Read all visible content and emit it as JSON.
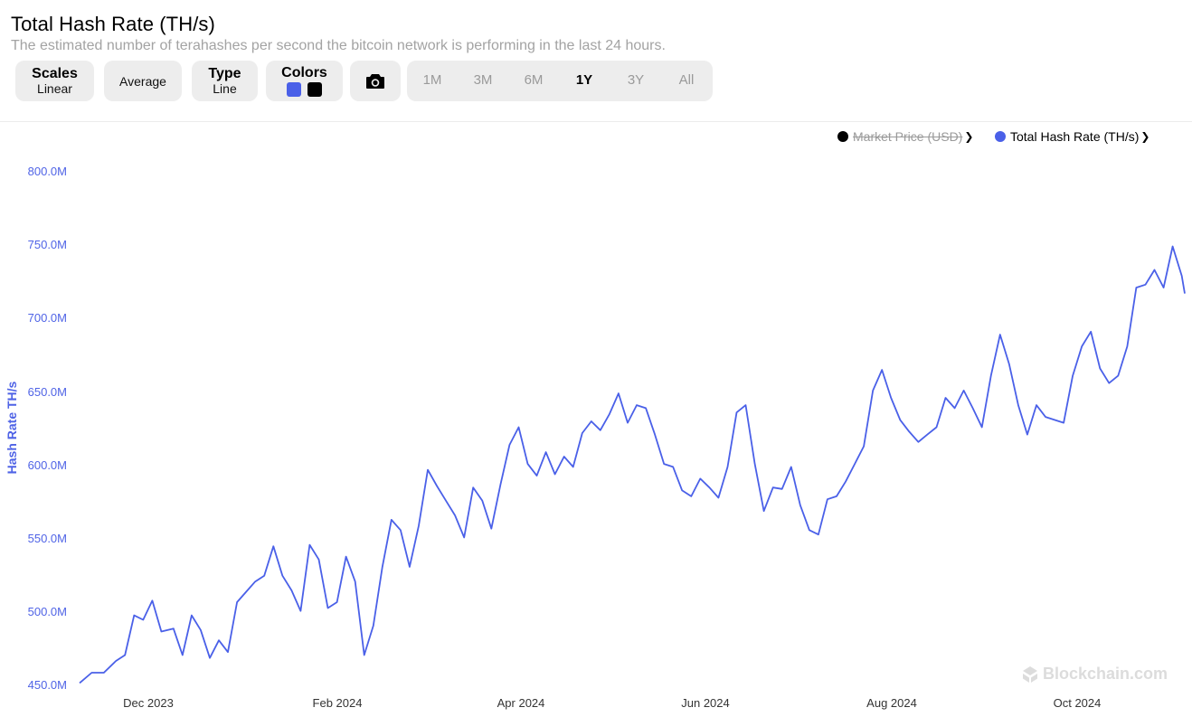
{
  "header": {
    "title": "Total Hash Rate (TH/s)",
    "subtitle": "The estimated number of terahashes per second the bitcoin network is performing in the last 24 hours."
  },
  "controls": {
    "scales": {
      "label": "Scales",
      "value": "Linear"
    },
    "average": {
      "label": "Average"
    },
    "type": {
      "label": "Type",
      "value": "Line"
    },
    "colors": {
      "label": "Colors",
      "swatch1": "#4a60e8",
      "swatch2": "#000000"
    },
    "camera": {
      "icon": "camera-icon"
    },
    "ranges": [
      "1M",
      "3M",
      "6M",
      "1Y",
      "3Y",
      "All"
    ],
    "active_range": "1Y"
  },
  "legend": [
    {
      "label": "Market Price (USD)",
      "color": "#000000",
      "enabled": false
    },
    {
      "label": "Total Hash Rate (TH/s)",
      "color": "#4a60e8",
      "enabled": true
    }
  ],
  "watermark": "Blockchain.com",
  "chart_data": {
    "type": "line",
    "title": "Total Hash Rate (TH/s)",
    "ylabel": "Hash Rate TH/s",
    "xlabel": "",
    "ylim": [
      450,
      800
    ],
    "y_unit": "M TH/s",
    "yticks": [
      "450.0M",
      "500.0M",
      "550.0M",
      "600.0M",
      "650.0M",
      "700.0M",
      "750.0M",
      "800.0M"
    ],
    "ytick_values": [
      450,
      500,
      550,
      600,
      650,
      700,
      750,
      800
    ],
    "xticks": [
      "Dec 2023",
      "Feb 2024",
      "Apr 2024",
      "Jun 2024",
      "Aug 2024",
      "Oct 2024"
    ],
    "xtick_dates": [
      "2023-12-01",
      "2024-02-01",
      "2024-04-01",
      "2024-06-01",
      "2024-08-01",
      "2024-10-01"
    ],
    "x_range": [
      "2023-11-12",
      "2024-11-11"
    ],
    "grid": false,
    "legend_position": "top-right",
    "series": [
      {
        "name": "Total Hash Rate (TH/s)",
        "color": "#4a60e8",
        "points": [
          [
            "2023-11-12",
            451
          ],
          [
            "2023-11-16",
            458
          ],
          [
            "2023-11-20",
            458
          ],
          [
            "2023-11-24",
            466
          ],
          [
            "2023-11-27",
            470
          ],
          [
            "2023-11-30",
            497
          ],
          [
            "2023-12-03",
            494
          ],
          [
            "2023-12-06",
            507
          ],
          [
            "2023-12-09",
            486
          ],
          [
            "2023-12-13",
            488
          ],
          [
            "2023-12-16",
            470
          ],
          [
            "2023-12-19",
            497
          ],
          [
            "2023-12-22",
            487
          ],
          [
            "2023-12-25",
            468
          ],
          [
            "2023-12-28",
            480
          ],
          [
            "2023-12-31",
            472
          ],
          [
            "2024-01-03",
            506
          ],
          [
            "2024-01-06",
            513
          ],
          [
            "2024-01-09",
            520
          ],
          [
            "2024-01-12",
            524
          ],
          [
            "2024-01-15",
            544
          ],
          [
            "2024-01-18",
            524
          ],
          [
            "2024-01-21",
            514
          ],
          [
            "2024-01-24",
            500
          ],
          [
            "2024-01-27",
            545
          ],
          [
            "2024-01-30",
            535
          ],
          [
            "2024-02-02",
            502
          ],
          [
            "2024-02-05",
            506
          ],
          [
            "2024-02-08",
            537
          ],
          [
            "2024-02-11",
            520
          ],
          [
            "2024-02-14",
            470
          ],
          [
            "2024-02-17",
            490
          ],
          [
            "2024-02-20",
            530
          ],
          [
            "2024-02-23",
            562
          ],
          [
            "2024-02-26",
            555
          ],
          [
            "2024-02-29",
            530
          ],
          [
            "2024-03-03",
            558
          ],
          [
            "2024-03-06",
            596
          ],
          [
            "2024-03-09",
            585
          ],
          [
            "2024-03-12",
            575
          ],
          [
            "2024-03-15",
            565
          ],
          [
            "2024-03-18",
            550
          ],
          [
            "2024-03-21",
            584
          ],
          [
            "2024-03-24",
            575
          ],
          [
            "2024-03-27",
            556
          ],
          [
            "2024-03-30",
            586
          ],
          [
            "2024-04-02",
            613
          ],
          [
            "2024-04-05",
            625
          ],
          [
            "2024-04-08",
            600
          ],
          [
            "2024-04-11",
            592
          ],
          [
            "2024-04-14",
            608
          ],
          [
            "2024-04-17",
            593
          ],
          [
            "2024-04-20",
            605
          ],
          [
            "2024-04-23",
            598
          ],
          [
            "2024-04-26",
            621
          ],
          [
            "2024-04-29",
            629
          ],
          [
            "2024-05-02",
            623
          ],
          [
            "2024-05-05",
            634
          ],
          [
            "2024-05-08",
            648
          ],
          [
            "2024-05-11",
            628
          ],
          [
            "2024-05-14",
            640
          ],
          [
            "2024-05-17",
            638
          ],
          [
            "2024-05-20",
            620
          ],
          [
            "2024-05-23",
            600
          ],
          [
            "2024-05-26",
            598
          ],
          [
            "2024-05-29",
            582
          ],
          [
            "2024-06-01",
            578
          ],
          [
            "2024-06-04",
            590
          ],
          [
            "2024-06-07",
            584
          ],
          [
            "2024-06-10",
            577
          ],
          [
            "2024-06-13",
            598
          ],
          [
            "2024-06-16",
            635
          ],
          [
            "2024-06-19",
            640
          ],
          [
            "2024-06-22",
            600
          ],
          [
            "2024-06-25",
            568
          ],
          [
            "2024-06-28",
            584
          ],
          [
            "2024-07-01",
            583
          ],
          [
            "2024-07-04",
            598
          ],
          [
            "2024-07-07",
            572
          ],
          [
            "2024-07-10",
            555
          ],
          [
            "2024-07-13",
            552
          ],
          [
            "2024-07-16",
            576
          ],
          [
            "2024-07-19",
            578
          ],
          [
            "2024-07-22",
            588
          ],
          [
            "2024-07-25",
            600
          ],
          [
            "2024-07-28",
            612
          ],
          [
            "2024-07-31",
            650
          ],
          [
            "2024-08-03",
            664
          ],
          [
            "2024-08-06",
            645
          ],
          [
            "2024-08-09",
            630
          ],
          [
            "2024-08-12",
            622
          ],
          [
            "2024-08-15",
            615
          ],
          [
            "2024-08-18",
            620
          ],
          [
            "2024-08-21",
            625
          ],
          [
            "2024-08-24",
            645
          ],
          [
            "2024-08-27",
            638
          ],
          [
            "2024-08-30",
            650
          ],
          [
            "2024-09-02",
            638
          ],
          [
            "2024-09-05",
            625
          ],
          [
            "2024-09-08",
            660
          ],
          [
            "2024-09-11",
            688
          ],
          [
            "2024-09-14",
            668
          ],
          [
            "2024-09-17",
            640
          ],
          [
            "2024-09-20",
            620
          ],
          [
            "2024-09-23",
            640
          ],
          [
            "2024-09-26",
            632
          ],
          [
            "2024-09-29",
            630
          ],
          [
            "2024-10-02",
            628
          ],
          [
            "2024-10-05",
            660
          ],
          [
            "2024-10-08",
            680
          ],
          [
            "2024-10-11",
            690
          ],
          [
            "2024-10-14",
            665
          ],
          [
            "2024-10-17",
            655
          ],
          [
            "2024-10-20",
            660
          ],
          [
            "2024-10-23",
            680
          ],
          [
            "2024-10-26",
            720
          ],
          [
            "2024-10-29",
            722
          ],
          [
            "2024-11-01",
            732
          ],
          [
            "2024-11-04",
            720
          ],
          [
            "2024-11-07",
            748
          ],
          [
            "2024-11-10",
            728
          ],
          [
            "2024-11-11",
            716
          ]
        ]
      }
    ]
  }
}
